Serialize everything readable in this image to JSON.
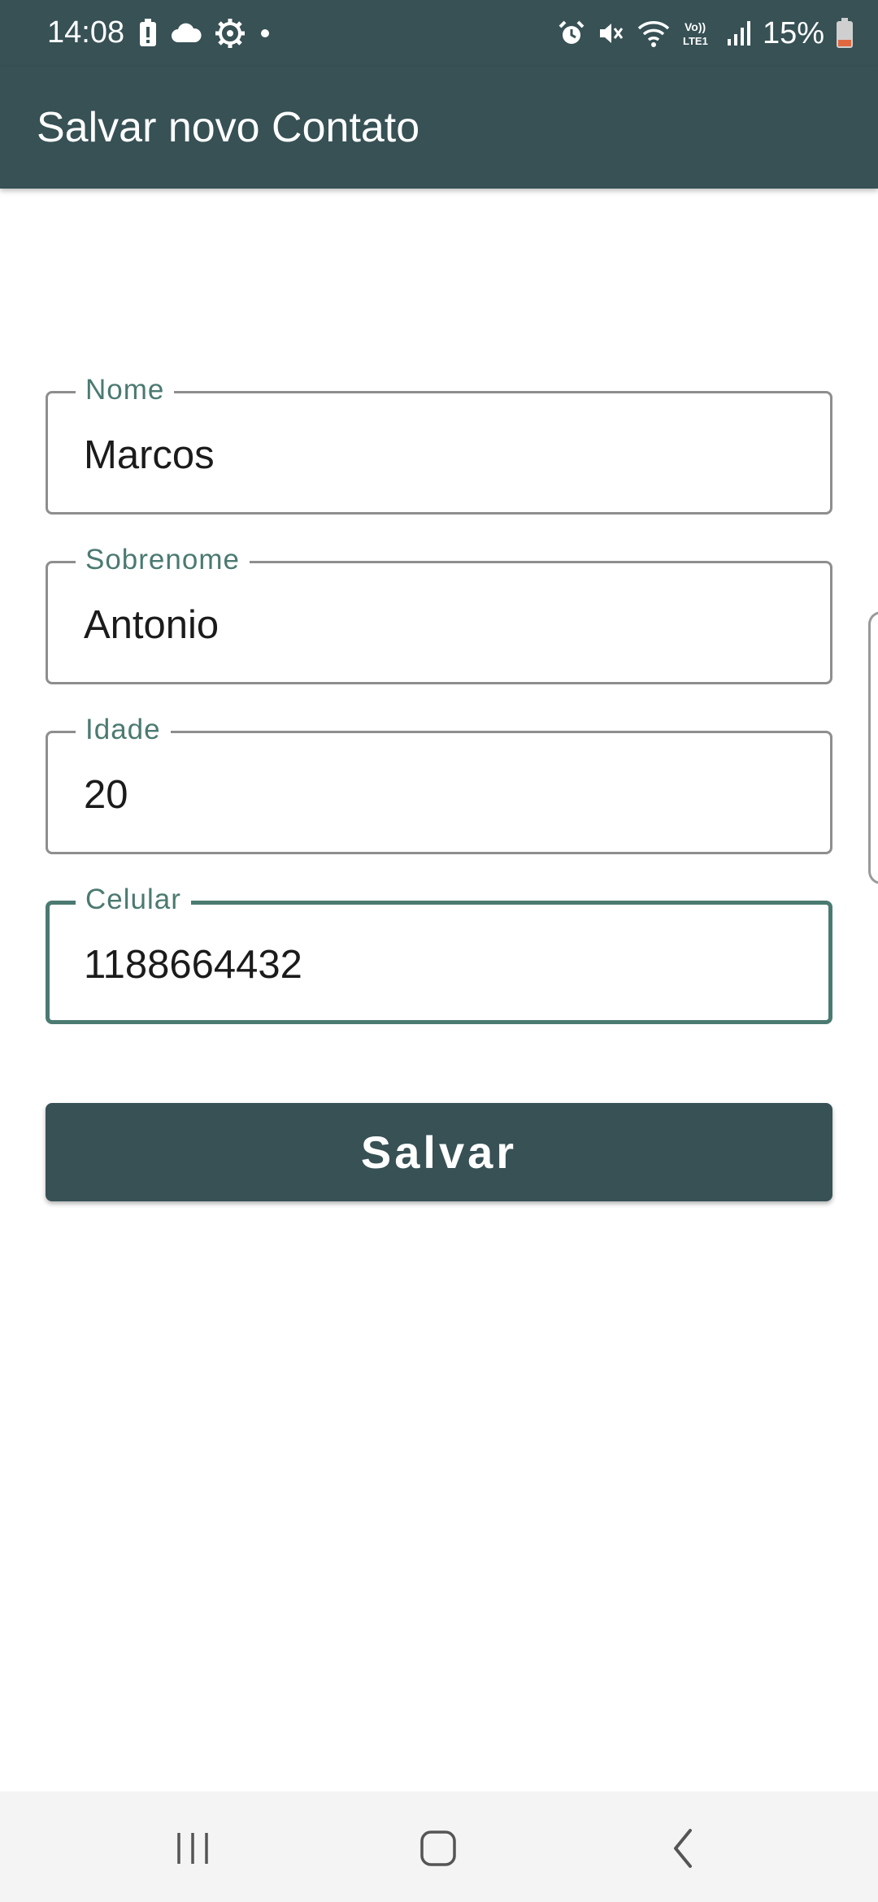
{
  "status_bar": {
    "time": "14:08",
    "battery_percent": "15%",
    "left_icons": [
      "battery-alert-icon",
      "cloud-icon",
      "settings-gear-icon",
      "dot-icon"
    ],
    "right_icons": [
      "alarm-icon",
      "mute-icon",
      "wifi-icon",
      "volte-icon",
      "signal-icon",
      "battery-icon"
    ],
    "volte_text": "Vo))\nLTE1"
  },
  "app_bar": {
    "title": "Salvar novo Contato"
  },
  "form": {
    "fields": [
      {
        "label": "Nome",
        "value": "Marcos",
        "focused": false
      },
      {
        "label": "Sobrenome",
        "value": "Antonio",
        "focused": false
      },
      {
        "label": "Idade",
        "value": "20",
        "focused": false
      },
      {
        "label": "Celular",
        "value": "1188664432",
        "focused": true
      }
    ],
    "save_label": "Salvar"
  },
  "colors": {
    "primary": "#375155",
    "label_accent": "#4b7a71",
    "battery_low": "#e0683f"
  },
  "nav_bar": {
    "buttons": [
      "recents-icon",
      "home-icon",
      "back-icon"
    ]
  }
}
